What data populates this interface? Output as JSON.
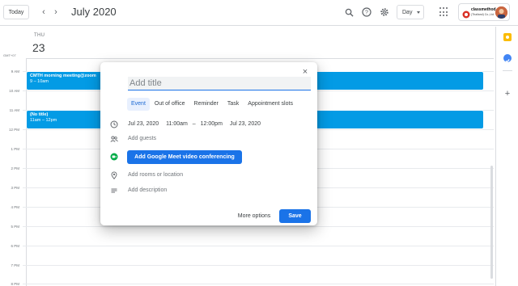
{
  "header": {
    "today_label": "Today",
    "month_title": "July 2020",
    "view_select": "Day",
    "brand_name": "classmethod",
    "brand_sub": "(Thailand) Co.,Ltd"
  },
  "calendar": {
    "day_of_week": "THU",
    "day_number": "23",
    "timezone": "GMT+07",
    "hours": [
      "9 AM",
      "10 AM",
      "11 AM",
      "12 PM",
      "1 PM",
      "2 PM",
      "3 PM",
      "4 PM",
      "5 PM",
      "6 PM",
      "7 PM",
      "8 PM"
    ],
    "events": [
      {
        "title": "CMTH morning meeting@zoom",
        "time": "9 – 10am"
      },
      {
        "title": "(No title)",
        "time": "11am – 12pm"
      }
    ]
  },
  "dialog": {
    "title_placeholder": "Add title",
    "tabs": [
      "Event",
      "Out of office",
      "Reminder",
      "Task",
      "Appointment slots"
    ],
    "start_date": "Jul 23, 2020",
    "start_time": "11:00am",
    "dash": "–",
    "end_time": "12:00pm",
    "end_date": "Jul 23, 2020",
    "add_guests": "Add guests",
    "meet_button": "Add Google Meet video conferencing",
    "add_location": "Add rooms or location",
    "add_description": "Add description",
    "more_options": "More options",
    "save": "Save"
  },
  "colors": {
    "event_blue": "#039be5",
    "primary_blue": "#1a73e8",
    "keep_yellow": "#fbbc04",
    "tasks_blue": "#4285f4"
  }
}
